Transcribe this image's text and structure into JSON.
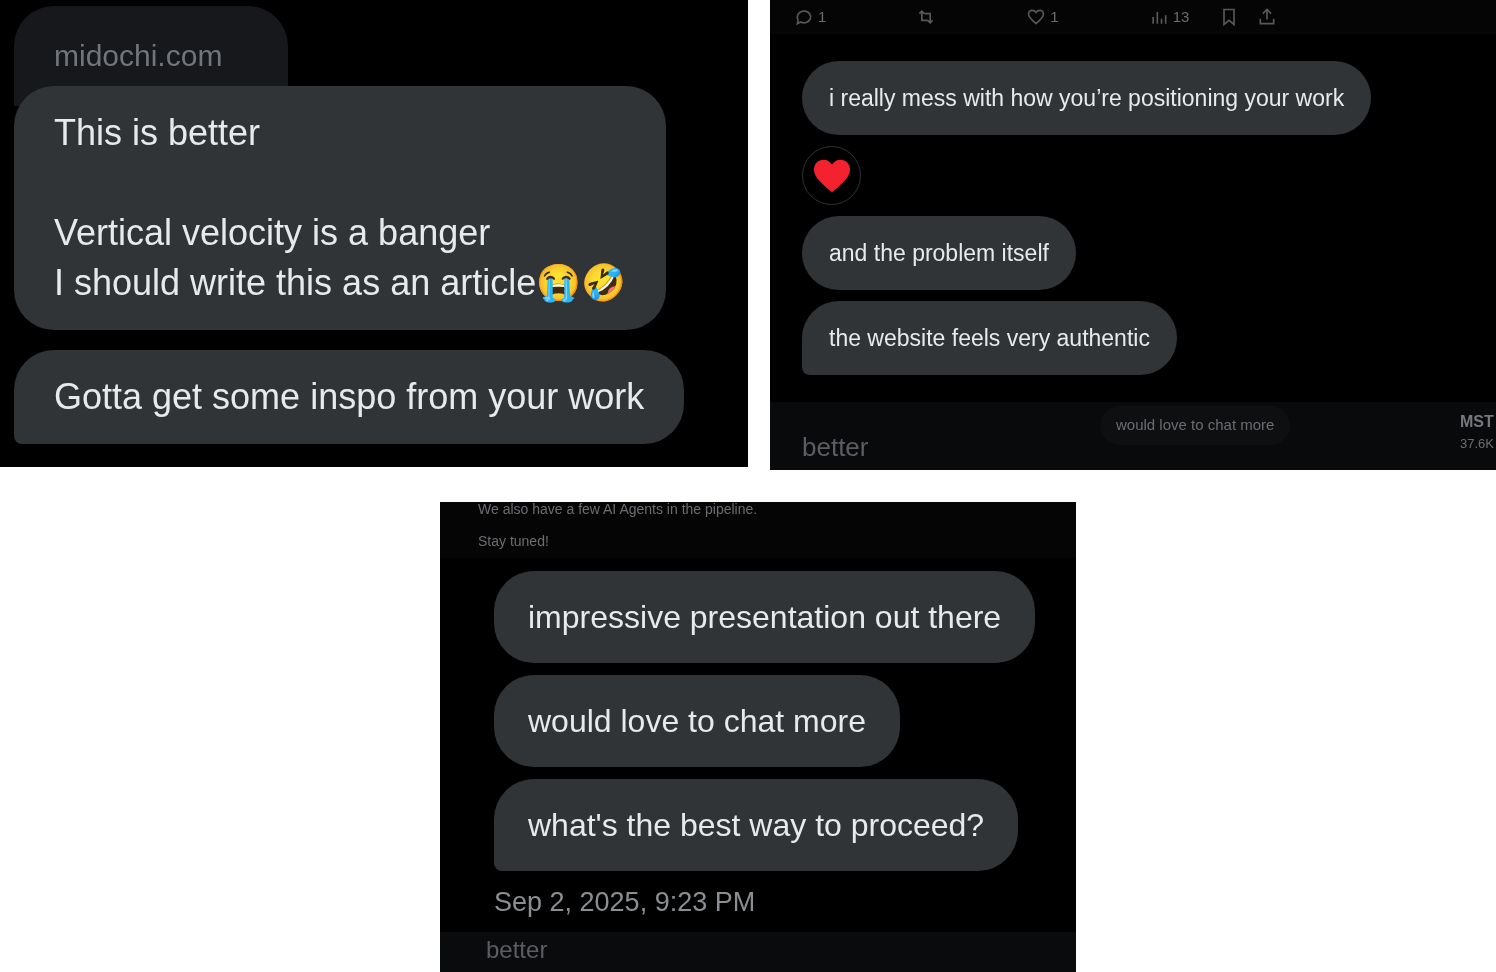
{
  "panels": [
    {
      "kind": "thread_a",
      "link_preview": "midochi.com",
      "messages": [
        {
          "kind": "text",
          "paragraphs": [
            "This is better",
            "Vertical velocity is a banger\nI should write this as an article😭🤣"
          ]
        },
        {
          "kind": "text",
          "paragraphs": [
            "Gotta get some inspo from your work"
          ]
        }
      ]
    },
    {
      "kind": "thread_b",
      "toolbar": {
        "reply_count": "1",
        "like_count": "1",
        "view_count": "13"
      },
      "messages": [
        {
          "kind": "text",
          "paragraphs": [
            "i really mess with how you’re positioning your work"
          ]
        },
        {
          "kind": "reaction"
        },
        {
          "kind": "text",
          "paragraphs": [
            "and the problem itself"
          ]
        },
        {
          "kind": "text",
          "paragraphs": [
            "the website feels very authentic"
          ]
        }
      ],
      "backdrop": {
        "left": "better",
        "bubble": "would love to chat more",
        "right_title": "MST",
        "right_count": "37.6K"
      }
    },
    {
      "kind": "thread_c",
      "backdrop_top": [
        "We also have a few AI Agents in the pipeline.",
        "Stay tuned!"
      ],
      "messages": [
        {
          "kind": "text",
          "paragraphs": [
            "impressive presentation out there"
          ]
        },
        {
          "kind": "text",
          "paragraphs": [
            "would love to chat more"
          ]
        },
        {
          "kind": "text",
          "paragraphs": [
            "what's the best way to proceed?"
          ]
        }
      ],
      "timestamp": "Sep 2, 2025, 9:23 PM",
      "backdrop_bottom": "better"
    }
  ]
}
